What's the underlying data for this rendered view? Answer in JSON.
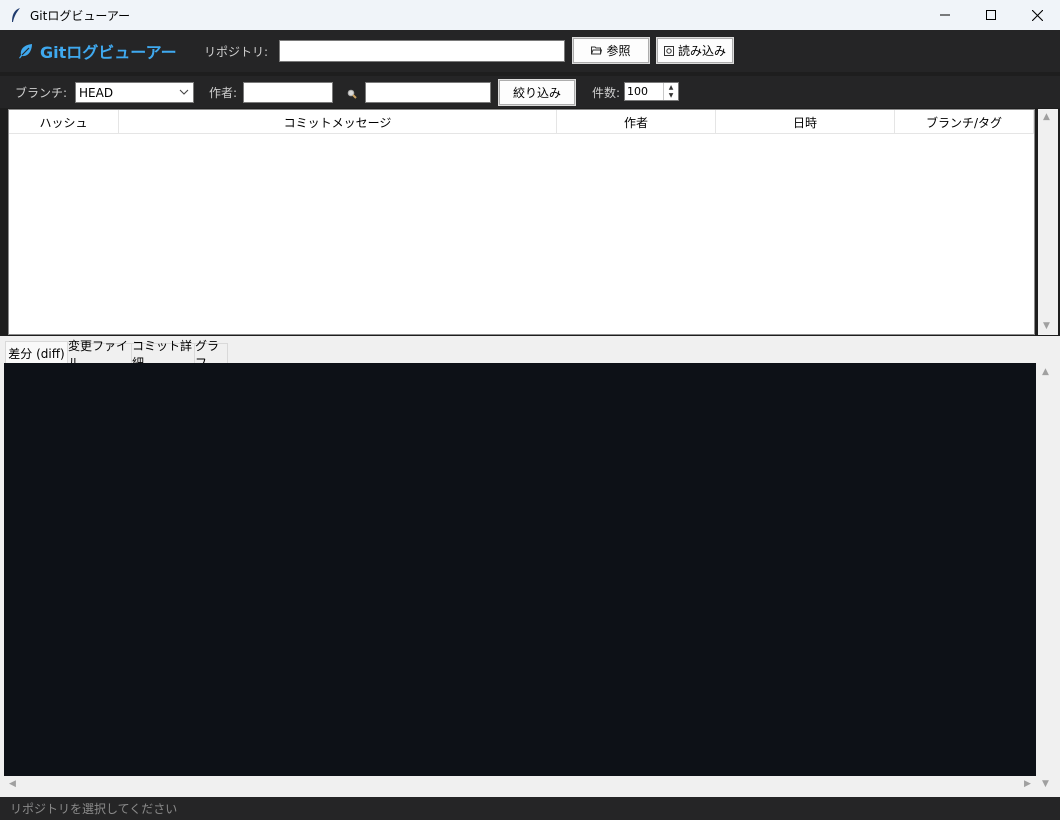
{
  "window": {
    "title": "Gitログビューアー",
    "controls": {
      "minimize": "—",
      "maximize": "☐",
      "close": "✕"
    }
  },
  "header": {
    "brand": "Gitログビューアー",
    "repo_label": "リポジトリ:",
    "repo_value": "",
    "browse_label": "参照",
    "load_label": "読み込み"
  },
  "filters": {
    "branch_label": "ブランチ:",
    "branch_value": "HEAD",
    "author_label": "作者:",
    "author_value": "",
    "search_value": "",
    "filter_button": "絞り込み",
    "count_label": "件数:",
    "count_value": "100"
  },
  "table": {
    "columns": [
      "ハッシュ",
      "コミットメッセージ",
      "作者",
      "日時",
      "ブランチ/タグ"
    ],
    "rows": []
  },
  "tabs": [
    "差分 (diff)",
    "変更ファイル",
    "コミット詳細",
    "グラフ"
  ],
  "status": "リポジトリを選択してください",
  "colors": {
    "brand": "#3fa9ef",
    "dark_bg": "#252526",
    "diff_bg": "#0d1117"
  },
  "icons": {
    "app": "feather-icon",
    "brand": "leaf-icon",
    "browse": "folder-open-icon",
    "load": "load-icon",
    "search": "magnifier-icon"
  }
}
